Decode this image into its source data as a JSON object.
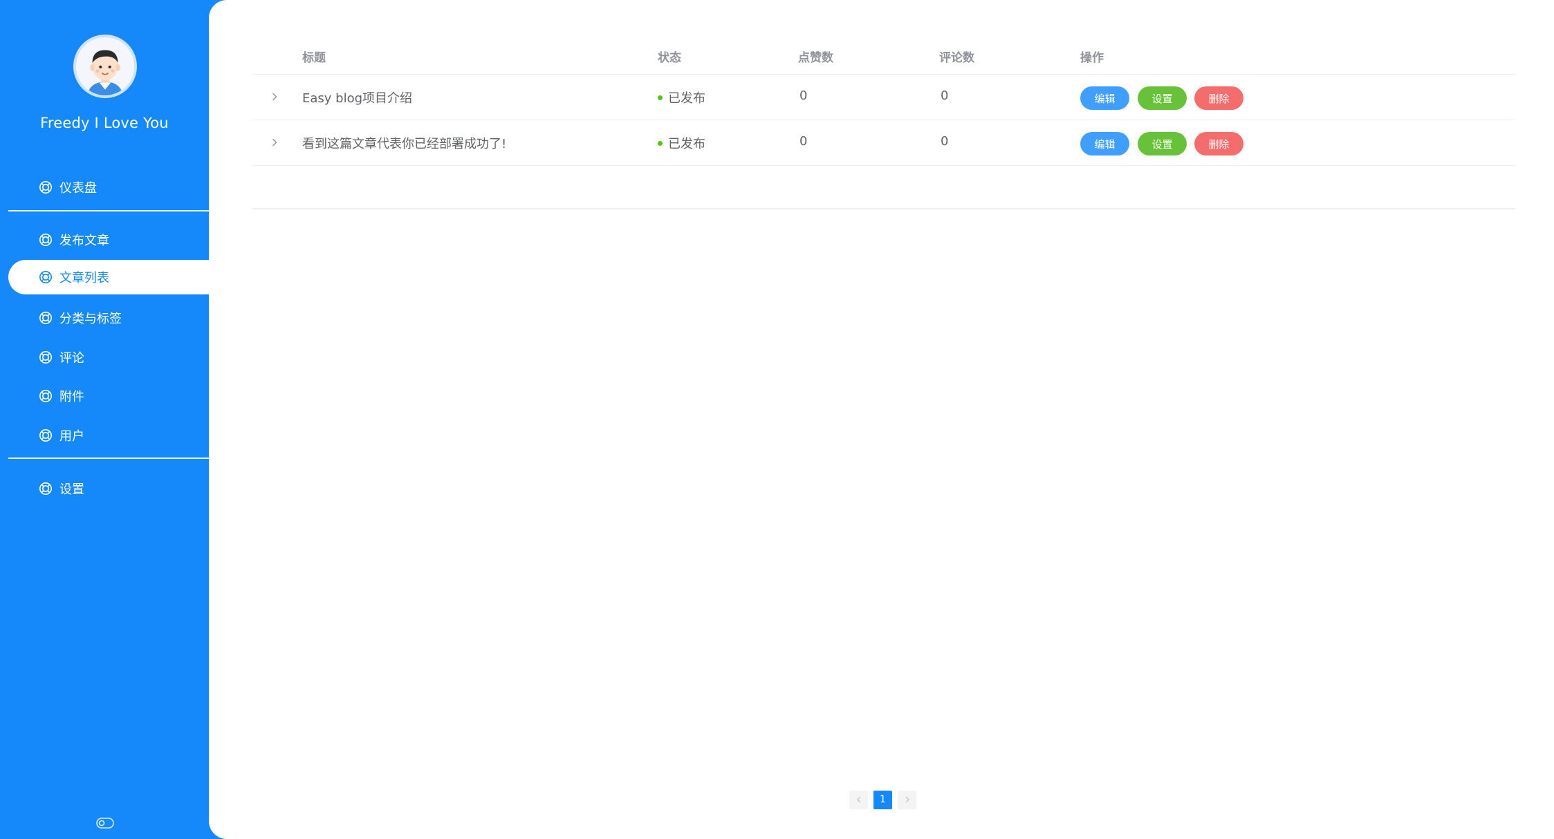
{
  "sidebar": {
    "username": "Freedy I Love You",
    "items": [
      {
        "label": "仪表盘",
        "icon": "ring-icon"
      },
      {
        "label": "发布文章",
        "icon": "ring-icon"
      },
      {
        "label": "文章列表",
        "icon": "ring-icon",
        "active": true
      },
      {
        "label": "分类与标签",
        "icon": "ring-icon"
      },
      {
        "label": "评论",
        "icon": "ring-icon"
      },
      {
        "label": "附件",
        "icon": "ring-icon"
      },
      {
        "label": "用户",
        "icon": "ring-icon"
      },
      {
        "label": "设置",
        "icon": "ring-icon"
      }
    ],
    "toggle_icon": "toggle-icon"
  },
  "table": {
    "headers": {
      "title": "标题",
      "status": "状态",
      "likes": "点赞数",
      "comments": "评论数",
      "actions": "操作"
    },
    "rows": [
      {
        "title": "Easy blog项目介绍",
        "status": "已发布",
        "likes": "0",
        "comments": "0"
      },
      {
        "title": "看到这篇文章代表你已经部署成功了!",
        "status": "已发布",
        "likes": "0",
        "comments": "0"
      }
    ],
    "action_labels": {
      "edit": "编辑",
      "settings": "设置",
      "delete": "删除"
    }
  },
  "pagination": {
    "current_page": "1"
  },
  "colors": {
    "primary": "#1589fa",
    "edit": "#409eff",
    "settings": "#67c23a",
    "delete": "#f56c6c",
    "status_published": "#52c41a"
  }
}
